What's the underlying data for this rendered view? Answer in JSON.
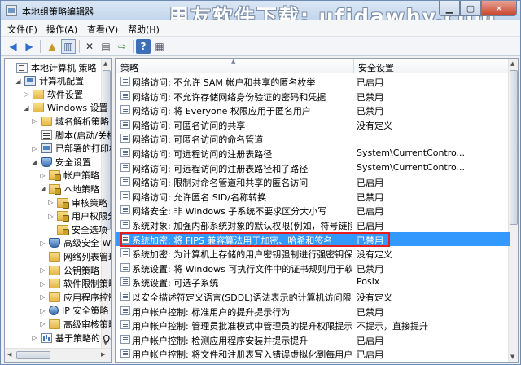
{
  "window": {
    "title": "本地组策略编辑器",
    "watermark": "用友软件下载: ufidawhy.com"
  },
  "menu": [
    "文件(F)",
    "操作(A)",
    "查看(V)",
    "帮助(H)"
  ],
  "tree": [
    {
      "label": "本地计算机 策略",
      "icon": "policy-icon",
      "indent": 0,
      "expander": ""
    },
    {
      "label": "计算机配置",
      "icon": "computer-icon",
      "indent": 1,
      "expander": "◢"
    },
    {
      "label": "软件设置",
      "icon": "folder-icon",
      "indent": 2,
      "expander": "▷"
    },
    {
      "label": "Windows 设置",
      "icon": "folder-icon",
      "indent": 2,
      "expander": "◢"
    },
    {
      "label": "域名解析策略",
      "icon": "folder-icon",
      "indent": 3,
      "expander": "▷"
    },
    {
      "label": "脚本(启动/关机)",
      "icon": "script-icon",
      "indent": 3,
      "expander": ""
    },
    {
      "label": "已部署的打印机",
      "icon": "printer-icon",
      "indent": 3,
      "expander": "▷"
    },
    {
      "label": "安全设置",
      "icon": "shield-icon",
      "indent": 3,
      "expander": "◢"
    },
    {
      "label": "帐户策略",
      "icon": "lock-folder-icon",
      "indent": 4,
      "expander": "▷"
    },
    {
      "label": "本地策略",
      "icon": "lock-folder-icon",
      "indent": 4,
      "expander": "◢"
    },
    {
      "label": "审核策略",
      "icon": "lock-folder-icon",
      "indent": 5,
      "expander": "▷"
    },
    {
      "label": "用户权限分配",
      "icon": "lock-folder-icon",
      "indent": 5,
      "expander": "▷"
    },
    {
      "label": "安全选项",
      "icon": "lock-folder-icon",
      "indent": 5,
      "expander": ""
    },
    {
      "label": "高级安全 Windows 防火墙",
      "icon": "firewall-icon",
      "indent": 4,
      "expander": "▷"
    },
    {
      "label": "网络列表管理器策略",
      "icon": "folder-icon",
      "indent": 4,
      "expander": ""
    },
    {
      "label": "公钥策略",
      "icon": "folder-icon",
      "indent": 4,
      "expander": "▷"
    },
    {
      "label": "软件限制策略",
      "icon": "folder-icon",
      "indent": 4,
      "expander": "▷"
    },
    {
      "label": "应用程序控制策略",
      "icon": "folder-icon",
      "indent": 4,
      "expander": "▷"
    },
    {
      "label": "IP 安全策略",
      "icon": "ip-security-icon",
      "indent": 4,
      "expander": "▷"
    },
    {
      "label": "高级审核策略配置",
      "icon": "folder-icon",
      "indent": 4,
      "expander": "▷"
    },
    {
      "label": "基于策略的 QoS",
      "icon": "chart-icon",
      "indent": 3,
      "expander": "▷"
    }
  ],
  "list": {
    "col_policy": "策略",
    "col_setting": "安全设置",
    "rows": [
      {
        "policy": "网络访问: 不允许 SAM 帐户和共享的匿名枚举",
        "setting": "已启用"
      },
      {
        "policy": "网络访问: 不允许存储网络身份验证的密码和凭据",
        "setting": "已禁用"
      },
      {
        "policy": "网络访问: 将 Everyone 权限应用于匿名用户",
        "setting": "已禁用"
      },
      {
        "policy": "网络访问: 可匿名访问的共享",
        "setting": "没有定义"
      },
      {
        "policy": "网络访问: 可匿名访问的命名管道",
        "setting": ""
      },
      {
        "policy": "网络访问: 可远程访问的注册表路径",
        "setting": "System\\CurrentContro..."
      },
      {
        "policy": "网络访问: 可远程访问的注册表路径和子路径",
        "setting": "System\\CurrentContro..."
      },
      {
        "policy": "网络访问: 限制对命名管道和共享的匿名访问",
        "setting": "已启用"
      },
      {
        "policy": "网络访问: 允许匿名 SID/名称转换",
        "setting": "已禁用"
      },
      {
        "policy": "网络安全: 非 Windows 子系统不要求区分大小写",
        "setting": "已启用"
      },
      {
        "policy": "系统对象: 加强内部系统对象的默认权限(例如，符号链接)",
        "setting": "已启用"
      },
      {
        "policy": "系统加密: 将 FIPS 兼容算法用于加密、哈希和签名",
        "setting": "已禁用",
        "selected": true
      },
      {
        "policy": "系统加密: 为计算机上存储的用户密钥强制进行强密钥保护",
        "setting": "没有定义"
      },
      {
        "policy": "系统设置: 将 Windows 可执行文件中的证书规则用于软件...",
        "setting": "已禁用"
      },
      {
        "policy": "系统设置: 可选子系统",
        "setting": "Posix"
      },
      {
        "policy": "以安全描述符定义语言(SDDL)语法表示的计算机访问限制",
        "setting": "没有定义"
      },
      {
        "policy": "用户帐户控制: 标准用户的提升提示行为",
        "setting": "已禁用"
      },
      {
        "policy": "用户帐户控制: 管理员批准模式中管理员的提升权限提示的...",
        "setting": "不提示，直接提升"
      },
      {
        "policy": "用户帐户控制: 检测应用程序安装并提示提升",
        "setting": "已启用"
      },
      {
        "policy": "用户帐户控制: 将文件和注册表写入错误虚拟化到每用户位置",
        "setting": "已启用"
      }
    ]
  },
  "colors": {
    "selection": "#3399ff",
    "highlight_box": "#e81c1c"
  }
}
